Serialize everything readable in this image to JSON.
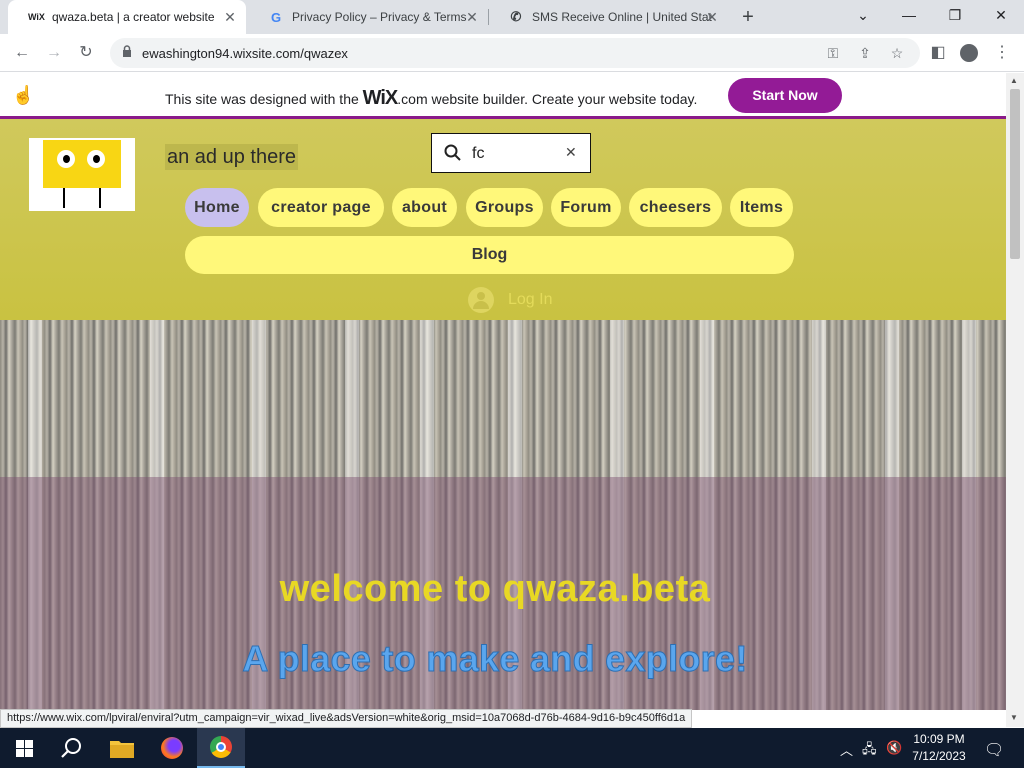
{
  "browser": {
    "tabs": [
      {
        "favicon": "WiX",
        "title": "qwaza.beta | a creator website",
        "active": true
      },
      {
        "favicon": "G",
        "title": "Privacy Policy – Privacy & Terms –",
        "active": false
      },
      {
        "favicon": "phone-icon",
        "title": "SMS Receive Online | United State",
        "active": false
      }
    ],
    "url": "ewashington94.wixsite.com/qwazex",
    "status_url": "https://www.wix.com/lpviral/enviral?utm_campaign=vir_wixad_live&adsVersion=white&orig_msid=10a7068d-d76b-4684-9d16-b9c450ff6d1a"
  },
  "wix_banner": {
    "message_before": "This site was designed with the ",
    "brand": "WiX",
    "message_after": ".com website builder. Create your website today.",
    "cta_label": "Start Now"
  },
  "site": {
    "tagline": "an ad up there",
    "search": {
      "value": "fc"
    },
    "nav": [
      {
        "label": "Home",
        "active": true
      },
      {
        "label": "creator page"
      },
      {
        "label": "about"
      },
      {
        "label": "Groups"
      },
      {
        "label": "Forum"
      },
      {
        "label": "cheesers"
      },
      {
        "label": "Items"
      }
    ],
    "blog_label": "Blog",
    "login_label": "Log In"
  },
  "hero": {
    "title": "welcome to qwaza.beta",
    "subtitle": "A place to make and explore!"
  },
  "taskbar": {
    "time": "10:09 PM",
    "date": "7/12/2023"
  },
  "colors": {
    "accent": "#931b96",
    "header_bg": "#ccc54f",
    "nav_pill": "#fff87a",
    "nav_active": "#c8c0ee",
    "hero_title": "#e8d824",
    "hero_subtitle": "#5aa6ee"
  }
}
